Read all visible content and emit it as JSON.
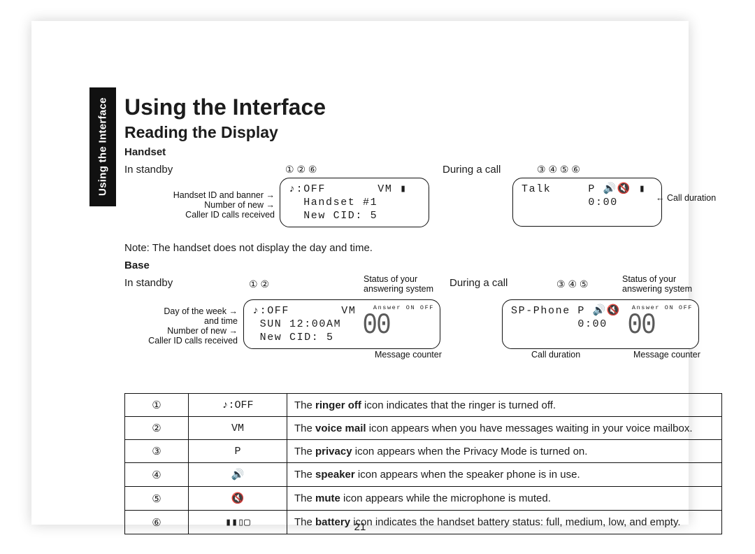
{
  "tab": "Using the Interface",
  "h1": "Using the Interface",
  "h2": "Reading the Display",
  "handset": {
    "label": "Handset",
    "standby": {
      "mode": "In standby",
      "callout_numbers": "①           ②  ⑥",
      "callout_a": "Handset ID and banner",
      "callout_b": "Number of new",
      "callout_c": "Caller ID calls received",
      "lcd_l1": "♪:OFF       VM ▮",
      "lcd_l2": "  Handset #1",
      "lcd_l3": "  New CID: 5"
    },
    "call": {
      "mode": "During a call",
      "callout_numbers": "③  ④ ⑤ ⑥",
      "callout_dur": "Call duration",
      "lcd_l1": "Talk     P 🔊🔇 ▮",
      "lcd_l2": "         0:00"
    },
    "note": "Note: The handset does not display the day and time."
  },
  "base": {
    "label": "Base",
    "standby": {
      "mode": "In standby",
      "callout_numbers": "①              ②",
      "callout_status": "Status of your",
      "callout_status2": "answering system",
      "answer_tag": "Answer ON OFF",
      "callout_day": "Day of the week",
      "callout_day2": "and time",
      "callout_new": "Number of new",
      "callout_new2": "Caller ID calls received",
      "msg_counter": "Message counter",
      "lcd_l1": "♪:OFF       VM",
      "lcd_l2": " SUN 12:00AM",
      "lcd_l3": " New CID: 5",
      "seg": "00"
    },
    "call": {
      "mode": "During a call",
      "callout_numbers": "③  ④ ⑤",
      "callout_status": "Status of your",
      "callout_status2": "answering system",
      "answer_tag": "Answer ON OFF",
      "msg_counter": "Message counter",
      "call_dur": "Call duration",
      "lcd_l1": "SP-Phone P 🔊🔇",
      "lcd_l2": "         0:00",
      "seg": "00"
    }
  },
  "legend": [
    {
      "n": "①",
      "icon": "♪:OFF",
      "bold": "ringer off",
      "rest": " icon indicates that the ringer is turned off."
    },
    {
      "n": "②",
      "icon": "VM",
      "bold": "voice mail",
      "rest": " icon appears when you have messages waiting in your voice mailbox."
    },
    {
      "n": "③",
      "icon": "P",
      "bold": "privacy",
      "rest": " icon appears when the Privacy Mode is turned on."
    },
    {
      "n": "④",
      "icon": "🔊",
      "bold": "speaker",
      "rest": " icon appears when the speaker phone is in use."
    },
    {
      "n": "⑤",
      "icon": "🔇",
      "bold": "mute",
      "rest": " icon appears while the microphone is muted."
    },
    {
      "n": "⑥",
      "icon": "▮▮▯▢",
      "bold": "battery",
      "rest": " icon indicates the handset battery status: full, medium, low, and empty."
    }
  ],
  "page_number": "21"
}
